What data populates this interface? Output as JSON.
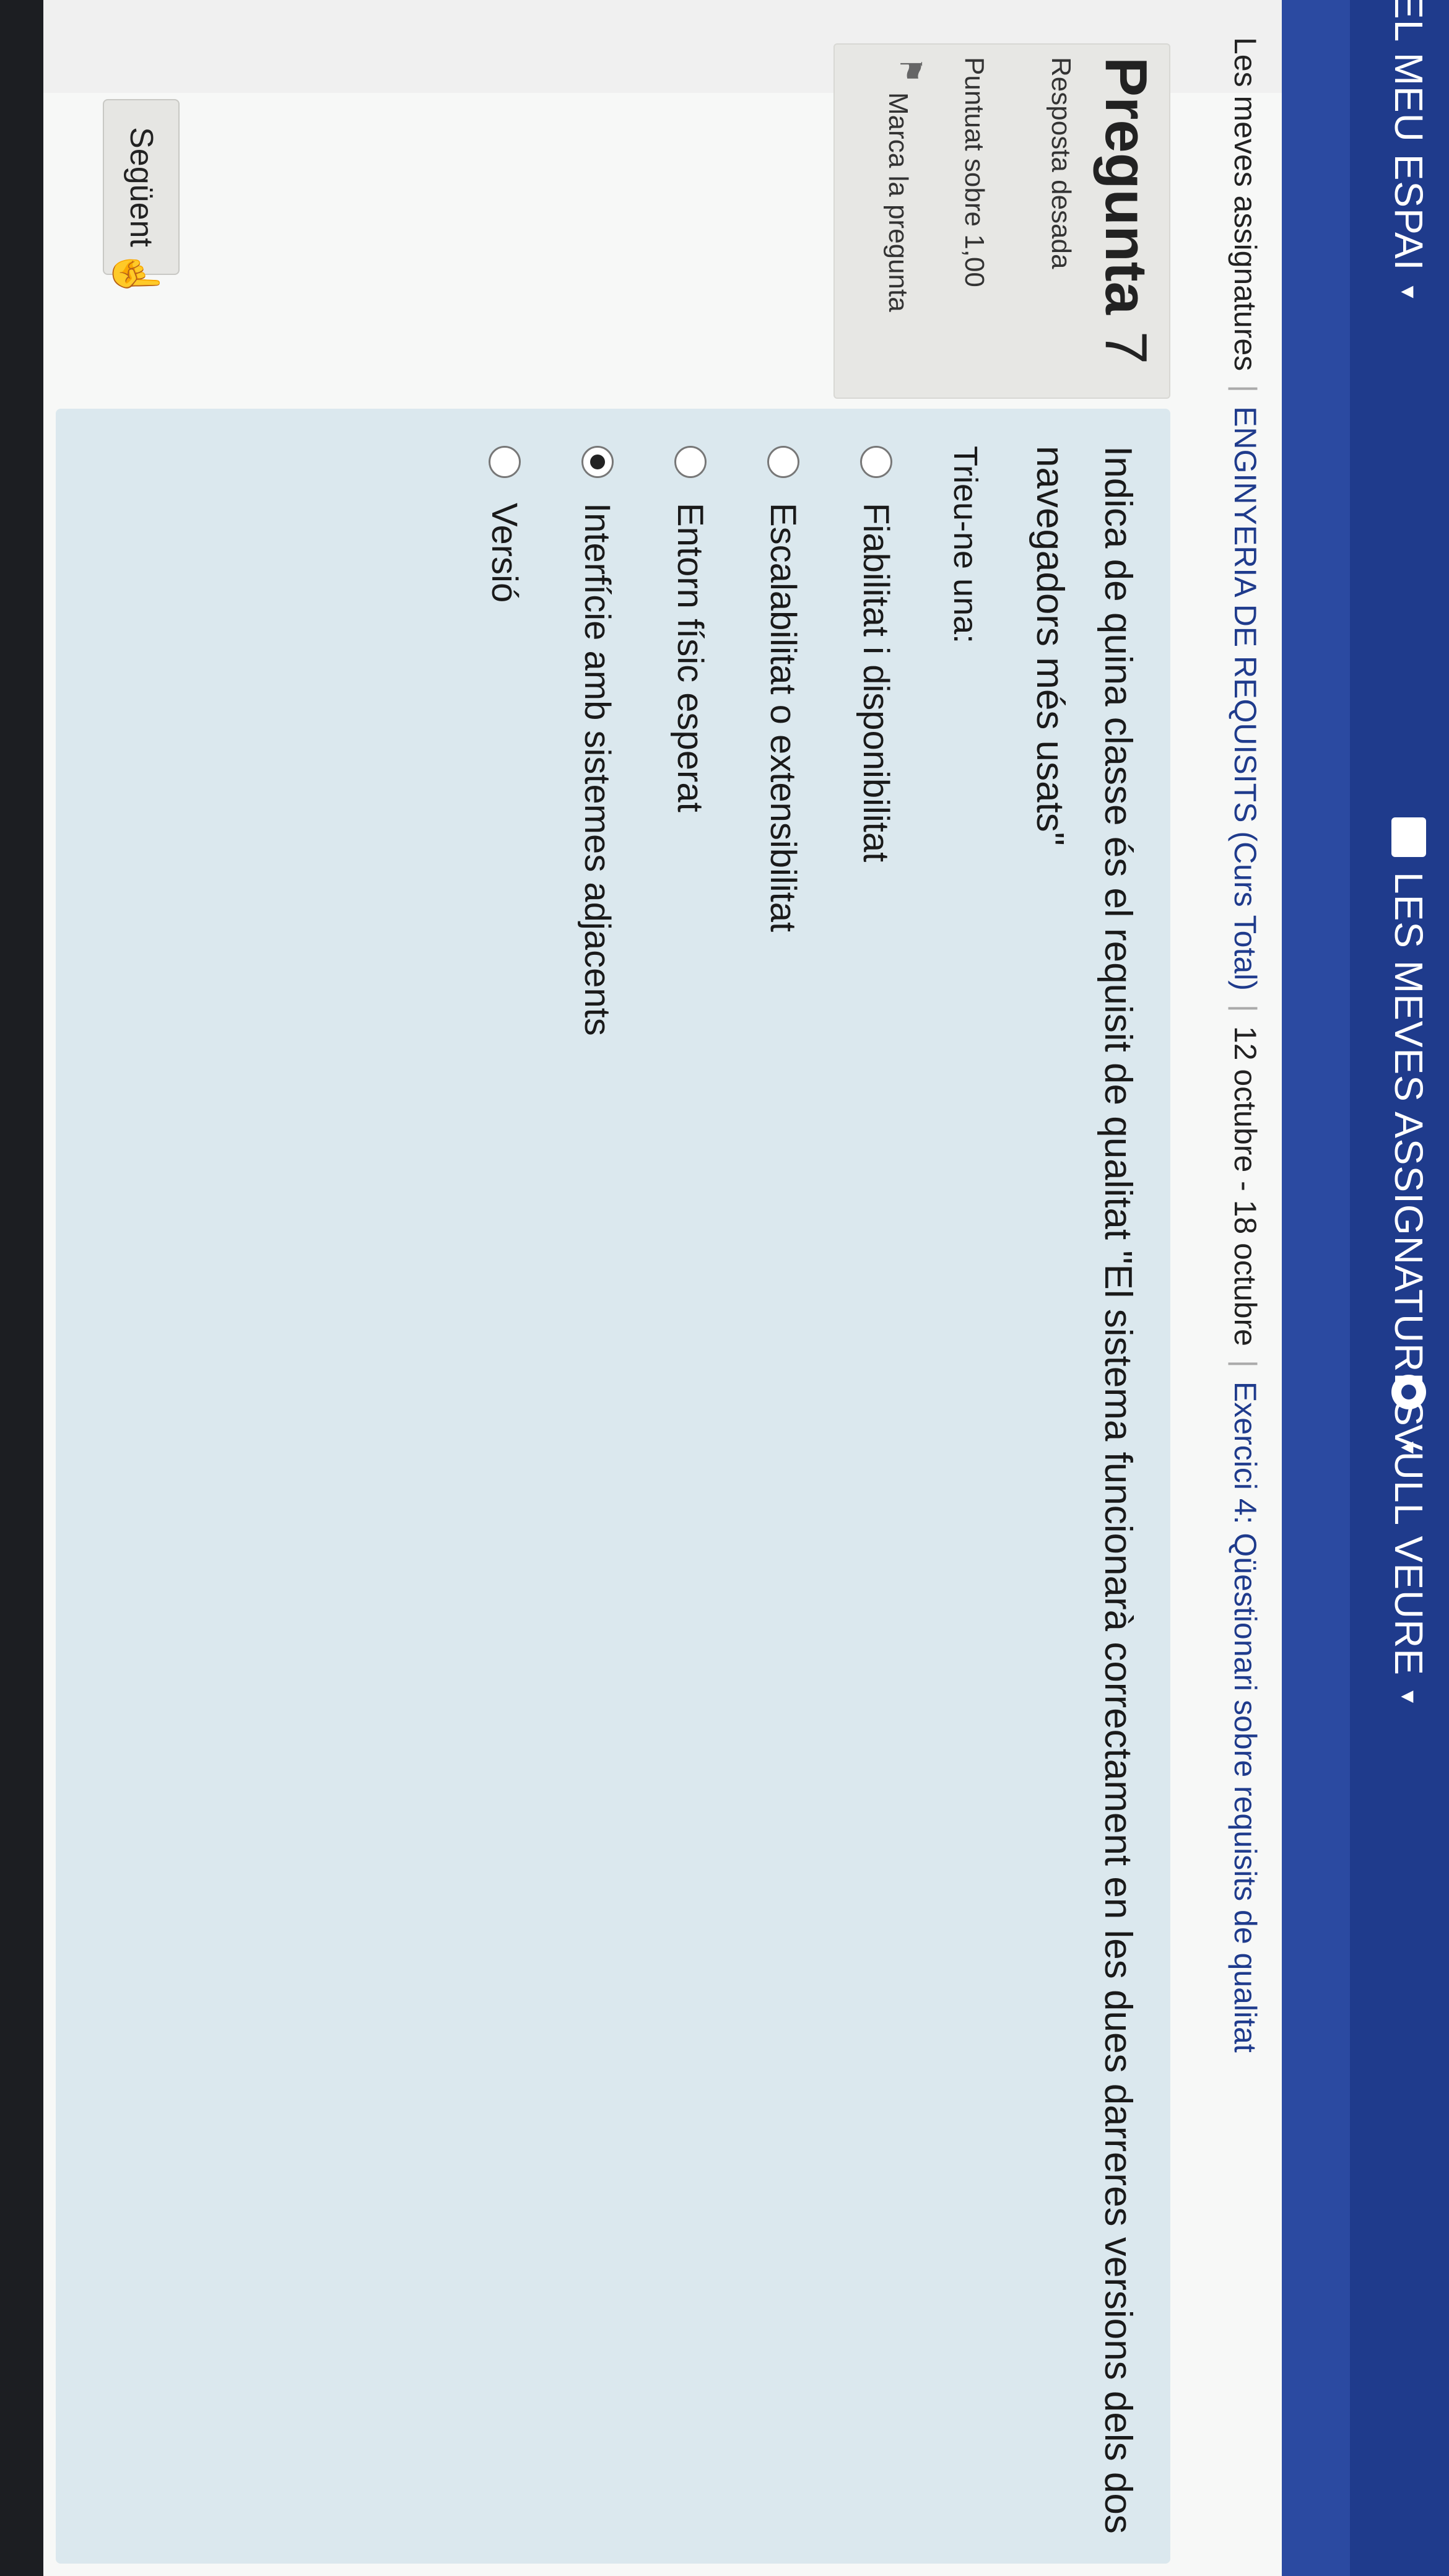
{
  "nav": {
    "items": [
      {
        "label": "EL MEU ESPAI",
        "icon": "house-icon"
      },
      {
        "label": "LES MEVES ASSIGNATURES",
        "icon": "book-icon"
      },
      {
        "label": "VULL VEURE",
        "icon": "eye-icon"
      }
    ]
  },
  "breadcrumb": {
    "items": [
      "Les meves assignatures",
      "ENGINYERIA DE REQUISITS (Curs Total)",
      "12 octubre - 18 octubre",
      "Exercici 4: Qüestionari sobre requisits de qualitat"
    ]
  },
  "question": {
    "title": "Pregunta",
    "number": "7",
    "state": "Resposta desada",
    "grade": "Puntuat sobre 1,00",
    "flag_label": "Marca la pregunta",
    "text": "Indica de quina classe és el requisit de qualitat \"El sistema funcionarà correctament en les dues darreres versions dels dos navegadors més usats\"",
    "prompt": "Trieu-ne una:",
    "options": [
      {
        "label": "Fiabilitat i disponibilitat",
        "selected": false
      },
      {
        "label": "Escalabilitat o extensibilitat",
        "selected": false
      },
      {
        "label": "Entorn físic esperat",
        "selected": false
      },
      {
        "label": "Interfície amb sistemes adjacents",
        "selected": true
      },
      {
        "label": "Versió",
        "selected": false
      }
    ]
  },
  "buttons": {
    "next_label": "Següent"
  },
  "colors": {
    "nav_bg": "#1f3b8c",
    "panel_bg": "#dbe8ee",
    "info_bg": "#e7e7e4"
  }
}
